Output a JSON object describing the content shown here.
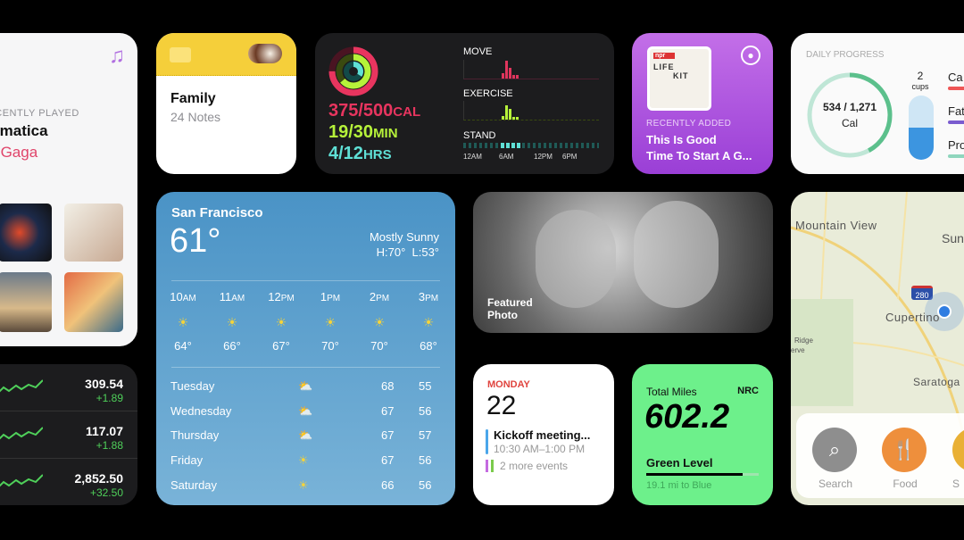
{
  "music": {
    "section": "RECENTLY PLAYED",
    "album": "Chromatica",
    "artist": "Lady Gaga",
    "icon": "music-note-icon"
  },
  "notes": {
    "folder": "Family",
    "count": "24 Notes",
    "icon": "folder-icon"
  },
  "activity": {
    "move": "375/500",
    "move_unit": "CAL",
    "exercise": "19/30",
    "exercise_unit": "MIN",
    "stand": "4/12",
    "stand_unit": "HRS",
    "labels": {
      "move": "MOVE",
      "exercise": "EXERCISE",
      "stand": "STAND"
    },
    "times": [
      "12AM",
      "6AM",
      "12PM",
      "6PM"
    ],
    "colors": {
      "move": "#e8355f",
      "exercise": "#b6f23a",
      "stand": "#5fe0d6"
    }
  },
  "podcast": {
    "section": "RECENTLY ADDED",
    "title_line1": "This Is Good",
    "title_line2": "Time To Start A G...",
    "art": {
      "brand": "npr",
      "words": [
        "LIFE",
        "KIT"
      ]
    }
  },
  "daily": {
    "title": "DAILY PROGRESS",
    "calories": "534 / 1,271",
    "cal_unit": "Cal",
    "cups": "2",
    "cups_label": "cups",
    "macros": [
      "Ca",
      "Fat",
      "Pro"
    ],
    "progress": 0.42
  },
  "weather": {
    "city": "San Francisco",
    "temp": "61°",
    "condition": "Mostly Sunny",
    "hilo": "H:70°  L:53°",
    "hours": [
      {
        "h": "10",
        "p": "AM",
        "t": "64°"
      },
      {
        "h": "11",
        "p": "AM",
        "t": "66°"
      },
      {
        "h": "12",
        "p": "PM",
        "t": "67°"
      },
      {
        "h": "1",
        "p": "PM",
        "t": "70°"
      },
      {
        "h": "2",
        "p": "PM",
        "t": "70°"
      },
      {
        "h": "3",
        "p": "PM",
        "t": "68°"
      }
    ],
    "days": [
      {
        "d": "Tuesday",
        "hi": "68",
        "lo": "55",
        "icon": "partly-cloudy"
      },
      {
        "d": "Wednesday",
        "hi": "67",
        "lo": "56",
        "icon": "partly-cloudy"
      },
      {
        "d": "Thursday",
        "hi": "67",
        "lo": "57",
        "icon": "partly-cloudy"
      },
      {
        "d": "Friday",
        "hi": "67",
        "lo": "56",
        "icon": "sun"
      },
      {
        "d": "Saturday",
        "hi": "66",
        "lo": "56",
        "icon": "sun"
      }
    ]
  },
  "photo": {
    "label_line1": "Featured",
    "label_line2": "Photo"
  },
  "map": {
    "places": [
      "Mountain View",
      "Sunnyvale",
      "Cupertino",
      "Saratoga",
      "Ridge",
      "erve"
    ],
    "highway": "280",
    "buttons": [
      "Search",
      "Food",
      "S"
    ]
  },
  "stocks": [
    {
      "price": "309.54",
      "change": "+1.89"
    },
    {
      "price": "117.07",
      "change": "+1.88"
    },
    {
      "price": "2,852.50",
      "change": "+32.50"
    }
  ],
  "calendar": {
    "day": "MONDAY",
    "date": "22",
    "event": "Kickoff meeting...",
    "time": "10:30 AM–1:00 PM",
    "more": "2 more events"
  },
  "nrc": {
    "label": "Total Miles",
    "brand": "NRC",
    "miles": "602.2",
    "level": "Green Level",
    "to_next": "19.1 mi to Blue",
    "progress": 0.86
  }
}
